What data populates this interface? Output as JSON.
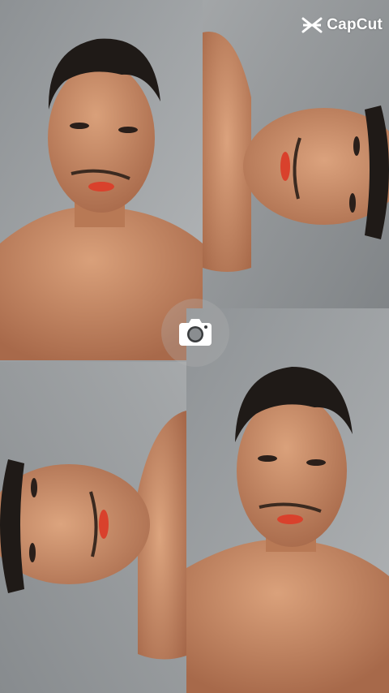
{
  "watermark": {
    "brand": "CapCut",
    "icon": "capcut-logo-icon"
  },
  "camera": {
    "icon": "camera-icon"
  },
  "photos": [
    {
      "position": "top-left",
      "orientation": "upright"
    },
    {
      "position": "top-right",
      "orientation": "rotated-90-clockwise"
    },
    {
      "position": "bottom-left",
      "orientation": "rotated-90-counterclockwise"
    },
    {
      "position": "bottom-right",
      "orientation": "upright"
    }
  ],
  "colors": {
    "background": "#9a9ea1",
    "skin": "#c98b67",
    "hair": "#1f1a17",
    "lips": "#d9412c",
    "watermark_text": "#ffffff"
  }
}
